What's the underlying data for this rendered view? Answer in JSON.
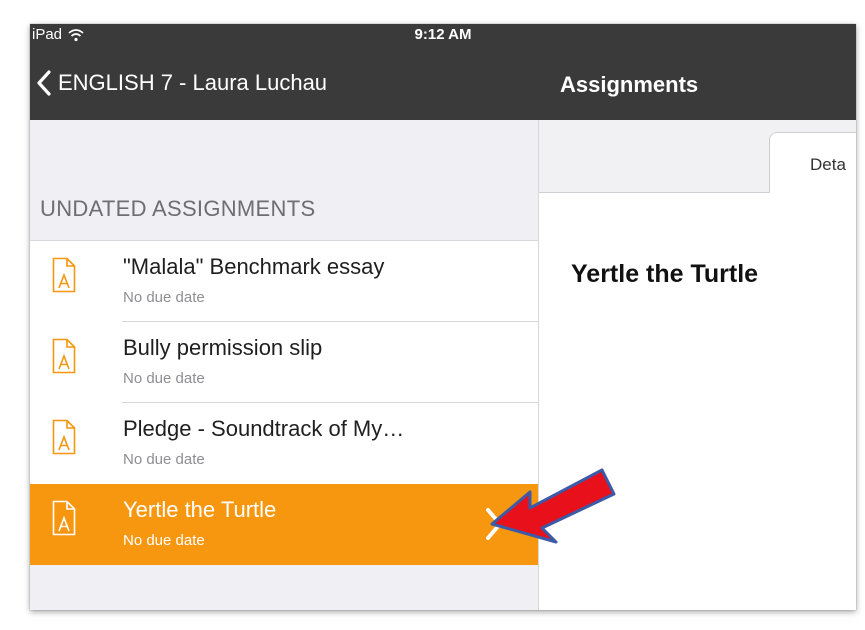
{
  "status_bar": {
    "carrier": "iPad",
    "time": "9:12 AM"
  },
  "nav_bar": {
    "back_label": "ENGLISH 7 - Laura Luchau",
    "title": "Assignments"
  },
  "master": {
    "section_header": "UNDATED ASSIGNMENTS",
    "items": [
      {
        "title": "\"Malala\" Benchmark essay",
        "subtitle": "No due date",
        "icon": "assignment-document-icon"
      },
      {
        "title": "Bully permission slip",
        "subtitle": "No due date",
        "icon": "assignment-document-icon"
      },
      {
        "title": "Pledge - Soundtrack of My…",
        "subtitle": "No due date",
        "icon": "assignment-document-icon"
      },
      {
        "title": "Yertle the Turtle",
        "subtitle": "No due date",
        "icon": "assignment-document-icon",
        "selected": true
      }
    ]
  },
  "detail": {
    "tab_label": "Deta",
    "title": "Yertle the Turtle"
  },
  "colors": {
    "nav_background": "#3a3a3a",
    "accent_orange": "#f7960f",
    "arrow_red": "#e8101a",
    "arrow_outline": "#3b5aa8"
  }
}
